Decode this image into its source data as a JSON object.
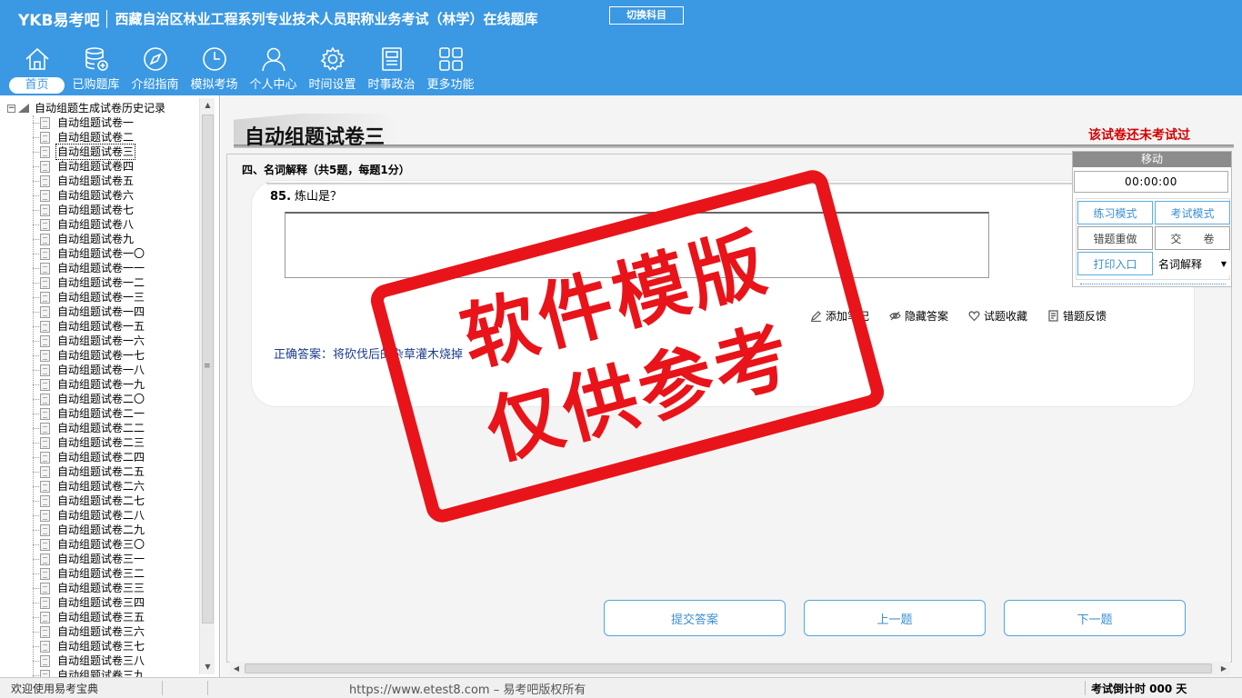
{
  "header": {
    "logo": "YKB易考吧",
    "exam_title": "西藏自治区林业工程系列专业技术人员职称业务考试（林学）在线题库",
    "switch_label": "切换科目",
    "nav": [
      {
        "label": "首页",
        "icon": "home-icon"
      },
      {
        "label": "已购题库",
        "icon": "database-icon"
      },
      {
        "label": "介绍指南",
        "icon": "compass-icon"
      },
      {
        "label": "模拟考场",
        "icon": "clock-icon"
      },
      {
        "label": "个人中心",
        "icon": "user-icon"
      },
      {
        "label": "时间设置",
        "icon": "gear-icon"
      },
      {
        "label": "时事政治",
        "icon": "news-icon"
      },
      {
        "label": "更多功能",
        "icon": "grid-icon"
      }
    ]
  },
  "tree": {
    "root_label": "自动组题生成试卷历史记录",
    "selected_index": 2,
    "items": [
      "自动组题试卷一",
      "自动组题试卷二",
      "自动组题试卷三",
      "自动组题试卷四",
      "自动组题试卷五",
      "自动组题试卷六",
      "自动组题试卷七",
      "自动组题试卷八",
      "自动组题试卷九",
      "自动组题试卷一〇",
      "自动组题试卷一一",
      "自动组题试卷一二",
      "自动组题试卷一三",
      "自动组题试卷一四",
      "自动组题试卷一五",
      "自动组题试卷一六",
      "自动组题试卷一七",
      "自动组题试卷一八",
      "自动组题试卷一九",
      "自动组题试卷二〇",
      "自动组题试卷二一",
      "自动组题试卷二二",
      "自动组题试卷二三",
      "自动组题试卷二四",
      "自动组题试卷二五",
      "自动组题试卷二六",
      "自动组题试卷二七",
      "自动组题试卷二八",
      "自动组题试卷二九",
      "自动组题试卷三〇",
      "自动组题试卷三一",
      "自动组题试卷三二",
      "自动组题试卷三三",
      "自动组题试卷三四",
      "自动组题试卷三五",
      "自动组题试卷三六",
      "自动组题试卷三七",
      "自动组题试卷三八",
      "自动组题试卷三九"
    ]
  },
  "main": {
    "paper_title": "自动组题试卷三",
    "exam_status": "该试卷还未考试过",
    "section_header": "四、名词解释（共5题，每题1分）",
    "question": {
      "number": "85.",
      "text": "炼山是？"
    },
    "answer_value": "",
    "actions": [
      {
        "label": "添加笔记",
        "icon": "pencil-icon"
      },
      {
        "label": "隐藏答案",
        "icon": "eye-icon"
      },
      {
        "label": "试题收藏",
        "icon": "heart-icon"
      },
      {
        "label": "错题反馈",
        "icon": "report-icon"
      }
    ],
    "correct_answer": "正确答案：将砍伐后的杂草灌木烧掉",
    "buttons": {
      "submit": "提交答案",
      "prev": "上一题",
      "next": "下一题"
    }
  },
  "control_panel": {
    "move_label": "移动",
    "timer": "00:00:00",
    "practice_mode": "练习模式",
    "exam_mode": "考试模式",
    "redo_wrong": "错题重做",
    "hand_in": "交　　卷",
    "print_entry": "打印入口",
    "section_select": "名词解释"
  },
  "stamp": {
    "line1": "软件模版",
    "line2": "仅供参考"
  },
  "status_bar": {
    "welcome": "欢迎使用易考宝典",
    "copyright": "https://www.etest8.com – 易考吧版权所有",
    "countdown": "考试倒计时 000 天"
  },
  "colors": {
    "header_bg": "#3b98e3",
    "accent": "#3b8fd1",
    "status_red": "#d40000",
    "stamp_red": "#e8141a"
  }
}
